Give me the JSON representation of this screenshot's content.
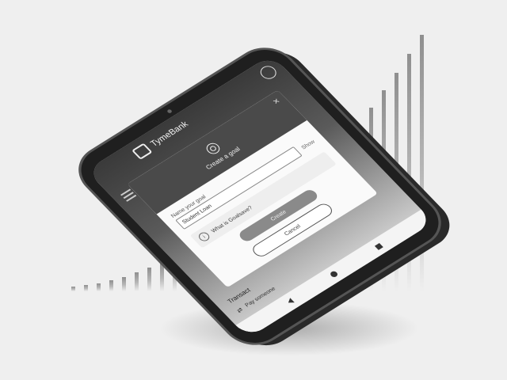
{
  "app": {
    "brand": "TymeBank"
  },
  "modal": {
    "title": "Create a goal",
    "goal_label": "Name your goal",
    "goal_value": "Student Loan",
    "show_label": "Show",
    "info_text": "What is Goalsave?",
    "info_icon_glyph": "i",
    "create_label": "Create",
    "cancel_label": "Cancel",
    "close_glyph": "×"
  },
  "main": {
    "section_title": "Transact",
    "pay_label": "Pay someone"
  },
  "icons": [
    "target-icon",
    "close-icon",
    "info-icon",
    "avatar-icon",
    "menu-icon",
    "pay-icon",
    "nav-back-icon",
    "nav-home-icon",
    "nav-recent-icon"
  ],
  "colors": {
    "background": "#efefef",
    "phone_body": "#1f1f1f",
    "modal_header": "#4a4a4a",
    "create_button": "#8a8a8a"
  }
}
